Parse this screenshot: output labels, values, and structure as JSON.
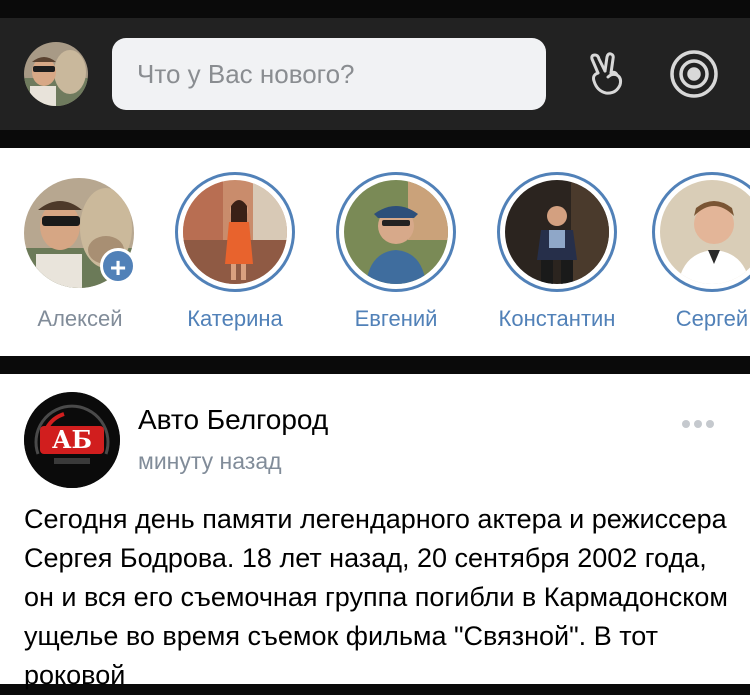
{
  "header": {
    "search_placeholder": "Что у Вас нового?",
    "icons": [
      "profile-avatar",
      "hand-victory-icon",
      "target-icon"
    ]
  },
  "stories": [
    {
      "name": "Алексей",
      "is_own": true
    },
    {
      "name": "Катерина",
      "is_own": false
    },
    {
      "name": "Евгений",
      "is_own": false
    },
    {
      "name": "Константин",
      "is_own": false
    },
    {
      "name": "Сергей",
      "is_own": false
    }
  ],
  "post": {
    "author": "Авто Белгород",
    "time": "минуту назад",
    "logo_text": "АБ",
    "text": "Сегодня день памяти легендарного актера и режиссера Сергея Бодрова. 18 лет назад, 20 сентября 2002 года, он и вся его съемочная группа погибли в Кармадонском ущелье во время съемок фильма \"Связной\". В тот роковой"
  },
  "colors": {
    "accent": "#5181b8",
    "header_bg": "#222222",
    "muted_text": "#818c99"
  }
}
